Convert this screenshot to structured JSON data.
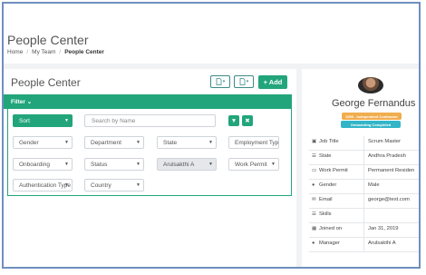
{
  "header": {
    "title": "People Center",
    "breadcrumb": [
      "Home",
      "My Team",
      "People Center"
    ]
  },
  "panel": {
    "title": "People Center",
    "add_label": "+ Add",
    "filter_label": "Filter"
  },
  "filters": {
    "sort": "Sort",
    "search_placeholder": "Search by Name",
    "gender": "Gender",
    "department": "Department",
    "state": "State",
    "employment_type": "Employment Type",
    "onboarding": "Onboarding",
    "status": "Status",
    "manager": "Arulsakthi A",
    "work_permit": "Work Permit",
    "authentication": "Authentication Type",
    "country": "Country"
  },
  "profile": {
    "name": "George Fernandus",
    "badge_type": "1099 - Independent Contractor",
    "badge_status": "Onboarding Completed",
    "details": [
      {
        "label": "Job Title",
        "value": "Scrum Master",
        "icon": "briefcase-icon"
      },
      {
        "label": "State",
        "value": "Andhra Pradesh",
        "icon": "list-icon"
      },
      {
        "label": "Work Permit",
        "value": "Permanent Residen",
        "icon": "id-card-icon"
      },
      {
        "label": "Gender",
        "value": "Male",
        "icon": "user-icon"
      },
      {
        "label": "Email",
        "value": "george@test.com",
        "icon": "envelope-icon"
      },
      {
        "label": "Skills",
        "value": "",
        "icon": "list-icon"
      },
      {
        "label": "Joined on",
        "value": "Jan 31, 2019",
        "icon": "calendar-icon"
      },
      {
        "label": "Manager",
        "value": "Arulsakthi A",
        "icon": "user-icon"
      }
    ]
  },
  "colors": {
    "accent": "#22a57a",
    "badge_orange": "#f0ad4e",
    "badge_teal": "#33b5c7"
  }
}
